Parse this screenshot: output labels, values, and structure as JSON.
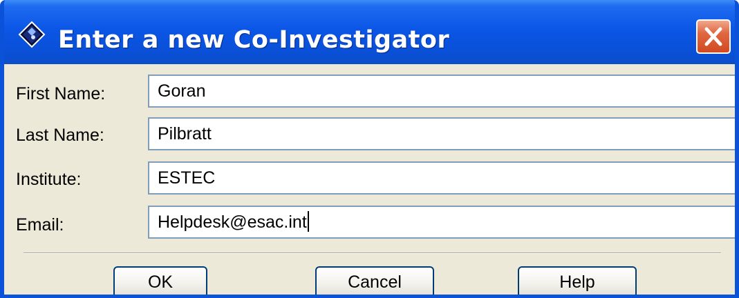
{
  "dialog": {
    "title": "Enter a new Co-Investigator",
    "icon": "app-diamond-icon",
    "close_icon": "close-x-icon"
  },
  "form": {
    "fields": [
      {
        "label": "First Name:",
        "value": "Goran"
      },
      {
        "label": "Last Name:",
        "value": "Pilbratt"
      },
      {
        "label": "Institute:",
        "value": "ESTEC"
      },
      {
        "label": "Email:",
        "value": "Helpdesk@esac.int"
      }
    ]
  },
  "buttons": {
    "ok": "OK",
    "cancel": "Cancel",
    "help": "Help"
  },
  "colors": {
    "titlebar": "#0a53d8",
    "close_button": "#e06640",
    "dialog_background": "#ece9d8",
    "field_border": "#7f9db9"
  }
}
